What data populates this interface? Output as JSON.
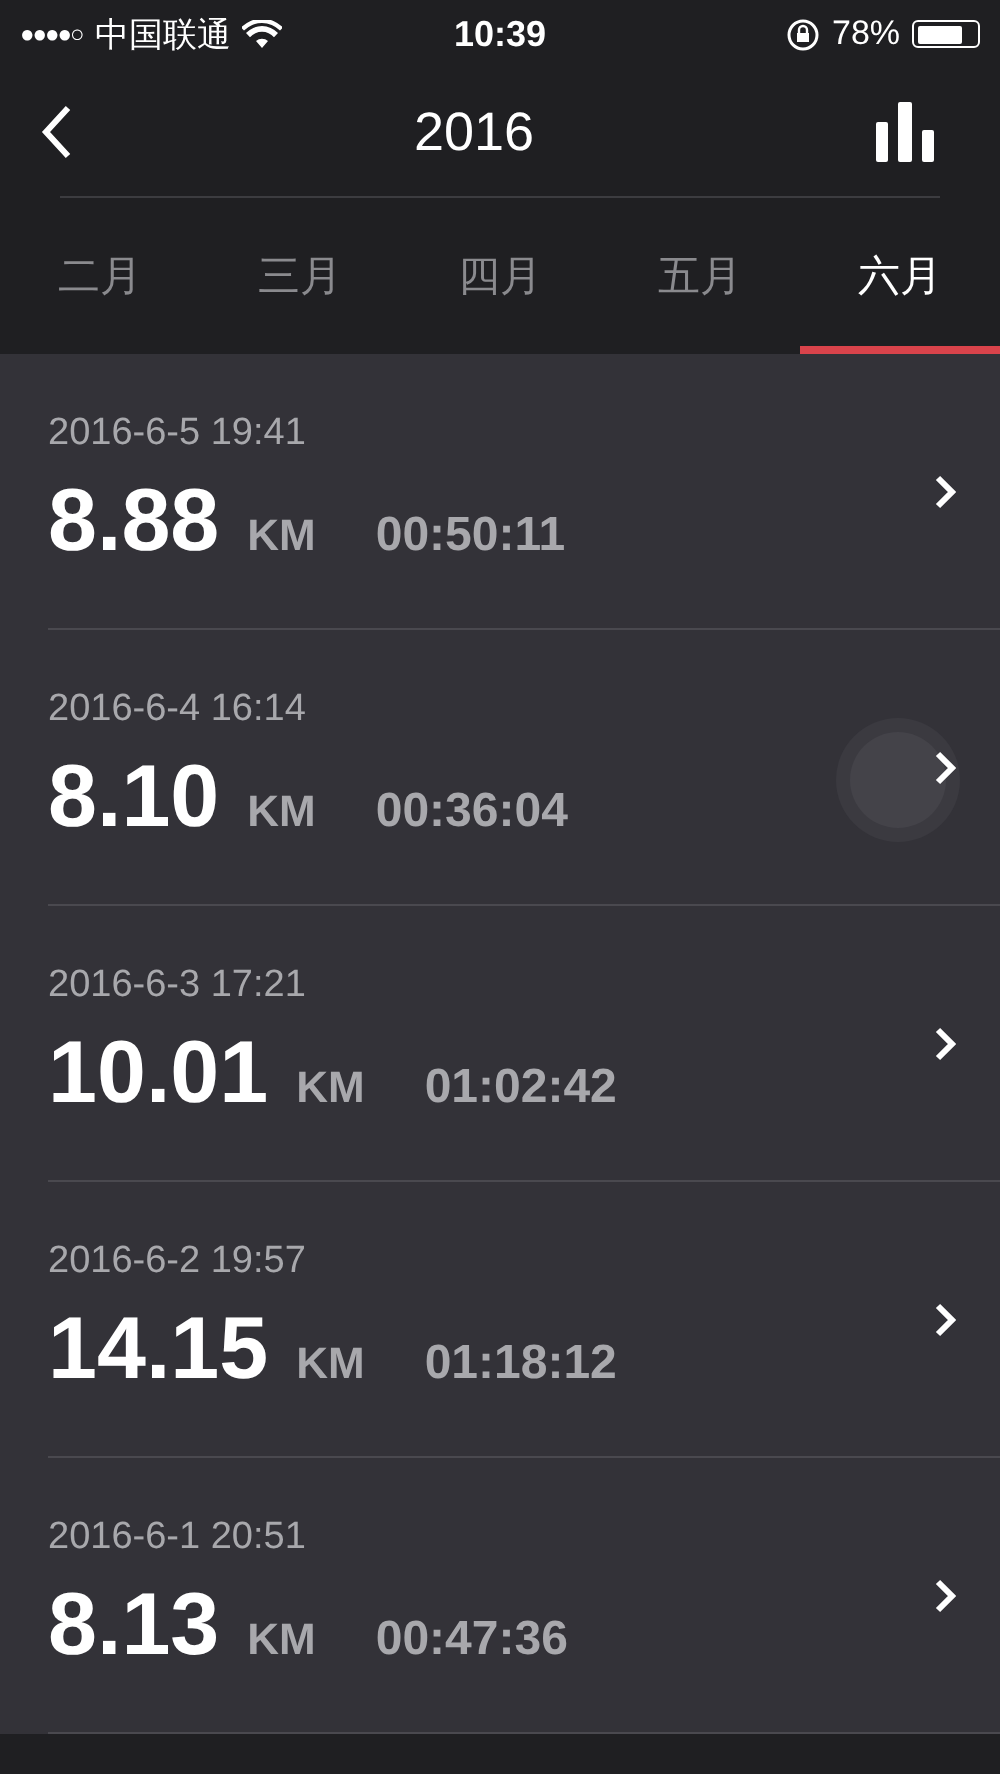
{
  "status_bar": {
    "signal_dots": "●●●●○",
    "carrier": "中国联通",
    "time": "10:39",
    "battery": "78%"
  },
  "nav": {
    "title": "2016"
  },
  "tabs": [
    {
      "label": "二月",
      "selected": false
    },
    {
      "label": "三月",
      "selected": false
    },
    {
      "label": "四月",
      "selected": false
    },
    {
      "label": "五月",
      "selected": false
    },
    {
      "label": "六月",
      "selected": true
    }
  ],
  "runs": [
    {
      "date": "2016-6-5 19:41",
      "distance": "8.88",
      "unit": "KM",
      "duration": "00:50:11"
    },
    {
      "date": "2016-6-4 16:14",
      "distance": "8.10",
      "unit": "KM",
      "duration": "00:36:04"
    },
    {
      "date": "2016-6-3 17:21",
      "distance": "10.01",
      "unit": "KM",
      "duration": "01:02:42"
    },
    {
      "date": "2016-6-2 19:57",
      "distance": "14.15",
      "unit": "KM",
      "duration": "01:18:12"
    },
    {
      "date": "2016-6-1 20:51",
      "distance": "8.13",
      "unit": "KM",
      "duration": "00:47:36"
    }
  ]
}
